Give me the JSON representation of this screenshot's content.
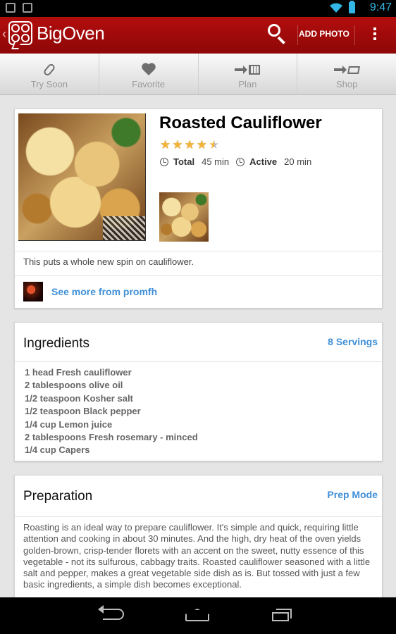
{
  "status_bar": {
    "time": "9:47"
  },
  "action_bar": {
    "brand": "BigOven",
    "add_photo": "ADD PHOTO"
  },
  "tabs": [
    {
      "label": "Try Soon",
      "icon": "paperclip-icon"
    },
    {
      "label": "Favorite",
      "icon": "heart-icon"
    },
    {
      "label": "Plan",
      "icon": "calendar-icon"
    },
    {
      "label": "Shop",
      "icon": "cart-icon"
    }
  ],
  "recipe": {
    "title": "Roasted Cauliflower",
    "rating": 4.5,
    "total_label": "Total",
    "total_time": "45 min",
    "active_label": "Active",
    "active_time": "20 min",
    "description": "This puts a whole new spin on cauliflower.",
    "author_link": "See more from promfh"
  },
  "ingredients": {
    "title": "Ingredients",
    "servings": "8 Servings",
    "items": [
      "1 head Fresh cauliflower",
      "2 tablespoons olive oil",
      "1/2 teaspoon Kosher salt",
      "1/2 teaspoon Black pepper",
      "1/4 cup Lemon juice",
      "2 tablespoons Fresh rosemary - minced",
      "1/4 cup Capers"
    ]
  },
  "preparation": {
    "title": "Preparation",
    "mode_link": "Prep Mode",
    "text": "Roasting is an ideal way to prepare cauliflower. It's simple and quick, requiring little attention and cooking in about 30 minutes. And the high, dry heat of the oven yields golden-brown, crisp-tender florets with an accent on the sweet, nutty essence of this vegetable - not its sulfurous, cabbagy traits. Roasted cauliflower seasoned with a little salt and pepper, makes a great vegetable side dish as is. But tossed with just a few basic ingredients, a simple dish becomes exceptional."
  },
  "colors": {
    "action_bar": "#a00a0a",
    "link": "#3f8fd8",
    "star": "#f3b43a",
    "status_accent": "#33b5e5"
  }
}
